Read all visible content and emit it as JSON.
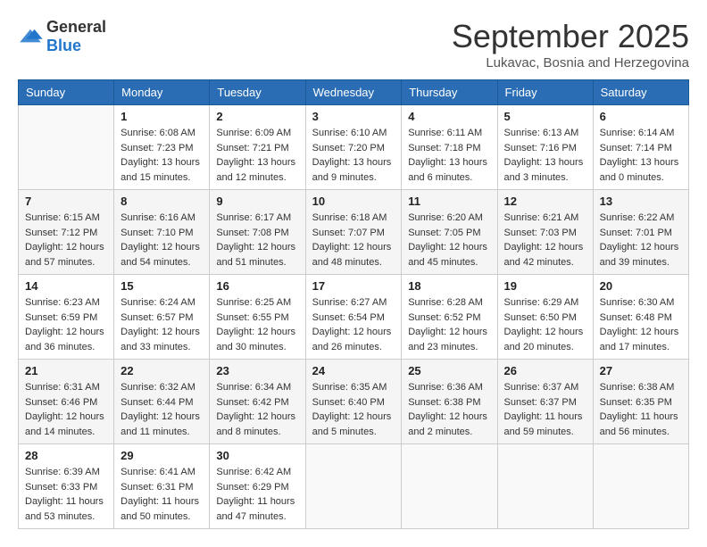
{
  "logo": {
    "general": "General",
    "blue": "Blue"
  },
  "title": "September 2025",
  "location": "Lukavac, Bosnia and Herzegovina",
  "weekdays": [
    "Sunday",
    "Monday",
    "Tuesday",
    "Wednesday",
    "Thursday",
    "Friday",
    "Saturday"
  ],
  "weeks": [
    [
      {
        "day": "",
        "sunrise": "",
        "sunset": "",
        "daylight": ""
      },
      {
        "day": "1",
        "sunrise": "Sunrise: 6:08 AM",
        "sunset": "Sunset: 7:23 PM",
        "daylight": "Daylight: 13 hours and 15 minutes."
      },
      {
        "day": "2",
        "sunrise": "Sunrise: 6:09 AM",
        "sunset": "Sunset: 7:21 PM",
        "daylight": "Daylight: 13 hours and 12 minutes."
      },
      {
        "day": "3",
        "sunrise": "Sunrise: 6:10 AM",
        "sunset": "Sunset: 7:20 PM",
        "daylight": "Daylight: 13 hours and 9 minutes."
      },
      {
        "day": "4",
        "sunrise": "Sunrise: 6:11 AM",
        "sunset": "Sunset: 7:18 PM",
        "daylight": "Daylight: 13 hours and 6 minutes."
      },
      {
        "day": "5",
        "sunrise": "Sunrise: 6:13 AM",
        "sunset": "Sunset: 7:16 PM",
        "daylight": "Daylight: 13 hours and 3 minutes."
      },
      {
        "day": "6",
        "sunrise": "Sunrise: 6:14 AM",
        "sunset": "Sunset: 7:14 PM",
        "daylight": "Daylight: 13 hours and 0 minutes."
      }
    ],
    [
      {
        "day": "7",
        "sunrise": "Sunrise: 6:15 AM",
        "sunset": "Sunset: 7:12 PM",
        "daylight": "Daylight: 12 hours and 57 minutes."
      },
      {
        "day": "8",
        "sunrise": "Sunrise: 6:16 AM",
        "sunset": "Sunset: 7:10 PM",
        "daylight": "Daylight: 12 hours and 54 minutes."
      },
      {
        "day": "9",
        "sunrise": "Sunrise: 6:17 AM",
        "sunset": "Sunset: 7:08 PM",
        "daylight": "Daylight: 12 hours and 51 minutes."
      },
      {
        "day": "10",
        "sunrise": "Sunrise: 6:18 AM",
        "sunset": "Sunset: 7:07 PM",
        "daylight": "Daylight: 12 hours and 48 minutes."
      },
      {
        "day": "11",
        "sunrise": "Sunrise: 6:20 AM",
        "sunset": "Sunset: 7:05 PM",
        "daylight": "Daylight: 12 hours and 45 minutes."
      },
      {
        "day": "12",
        "sunrise": "Sunrise: 6:21 AM",
        "sunset": "Sunset: 7:03 PM",
        "daylight": "Daylight: 12 hours and 42 minutes."
      },
      {
        "day": "13",
        "sunrise": "Sunrise: 6:22 AM",
        "sunset": "Sunset: 7:01 PM",
        "daylight": "Daylight: 12 hours and 39 minutes."
      }
    ],
    [
      {
        "day": "14",
        "sunrise": "Sunrise: 6:23 AM",
        "sunset": "Sunset: 6:59 PM",
        "daylight": "Daylight: 12 hours and 36 minutes."
      },
      {
        "day": "15",
        "sunrise": "Sunrise: 6:24 AM",
        "sunset": "Sunset: 6:57 PM",
        "daylight": "Daylight: 12 hours and 33 minutes."
      },
      {
        "day": "16",
        "sunrise": "Sunrise: 6:25 AM",
        "sunset": "Sunset: 6:55 PM",
        "daylight": "Daylight: 12 hours and 30 minutes."
      },
      {
        "day": "17",
        "sunrise": "Sunrise: 6:27 AM",
        "sunset": "Sunset: 6:54 PM",
        "daylight": "Daylight: 12 hours and 26 minutes."
      },
      {
        "day": "18",
        "sunrise": "Sunrise: 6:28 AM",
        "sunset": "Sunset: 6:52 PM",
        "daylight": "Daylight: 12 hours and 23 minutes."
      },
      {
        "day": "19",
        "sunrise": "Sunrise: 6:29 AM",
        "sunset": "Sunset: 6:50 PM",
        "daylight": "Daylight: 12 hours and 20 minutes."
      },
      {
        "day": "20",
        "sunrise": "Sunrise: 6:30 AM",
        "sunset": "Sunset: 6:48 PM",
        "daylight": "Daylight: 12 hours and 17 minutes."
      }
    ],
    [
      {
        "day": "21",
        "sunrise": "Sunrise: 6:31 AM",
        "sunset": "Sunset: 6:46 PM",
        "daylight": "Daylight: 12 hours and 14 minutes."
      },
      {
        "day": "22",
        "sunrise": "Sunrise: 6:32 AM",
        "sunset": "Sunset: 6:44 PM",
        "daylight": "Daylight: 12 hours and 11 minutes."
      },
      {
        "day": "23",
        "sunrise": "Sunrise: 6:34 AM",
        "sunset": "Sunset: 6:42 PM",
        "daylight": "Daylight: 12 hours and 8 minutes."
      },
      {
        "day": "24",
        "sunrise": "Sunrise: 6:35 AM",
        "sunset": "Sunset: 6:40 PM",
        "daylight": "Daylight: 12 hours and 5 minutes."
      },
      {
        "day": "25",
        "sunrise": "Sunrise: 6:36 AM",
        "sunset": "Sunset: 6:38 PM",
        "daylight": "Daylight: 12 hours and 2 minutes."
      },
      {
        "day": "26",
        "sunrise": "Sunrise: 6:37 AM",
        "sunset": "Sunset: 6:37 PM",
        "daylight": "Daylight: 11 hours and 59 minutes."
      },
      {
        "day": "27",
        "sunrise": "Sunrise: 6:38 AM",
        "sunset": "Sunset: 6:35 PM",
        "daylight": "Daylight: 11 hours and 56 minutes."
      }
    ],
    [
      {
        "day": "28",
        "sunrise": "Sunrise: 6:39 AM",
        "sunset": "Sunset: 6:33 PM",
        "daylight": "Daylight: 11 hours and 53 minutes."
      },
      {
        "day": "29",
        "sunrise": "Sunrise: 6:41 AM",
        "sunset": "Sunset: 6:31 PM",
        "daylight": "Daylight: 11 hours and 50 minutes."
      },
      {
        "day": "30",
        "sunrise": "Sunrise: 6:42 AM",
        "sunset": "Sunset: 6:29 PM",
        "daylight": "Daylight: 11 hours and 47 minutes."
      },
      {
        "day": "",
        "sunrise": "",
        "sunset": "",
        "daylight": ""
      },
      {
        "day": "",
        "sunrise": "",
        "sunset": "",
        "daylight": ""
      },
      {
        "day": "",
        "sunrise": "",
        "sunset": "",
        "daylight": ""
      },
      {
        "day": "",
        "sunrise": "",
        "sunset": "",
        "daylight": ""
      }
    ]
  ]
}
